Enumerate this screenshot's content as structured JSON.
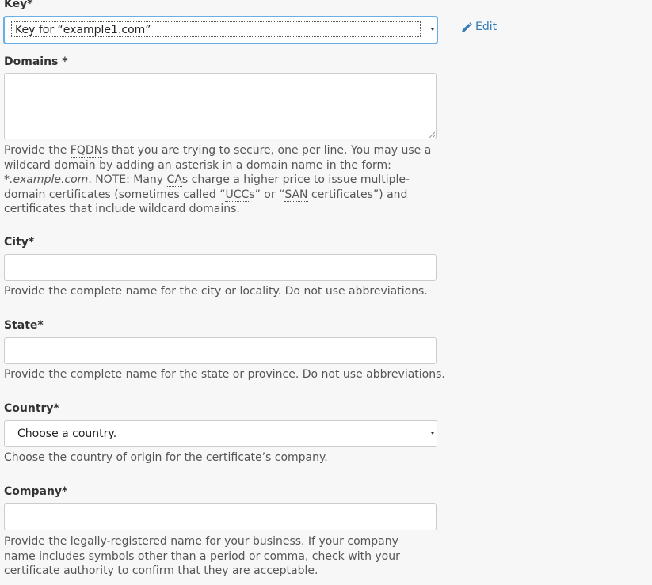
{
  "key": {
    "label": "Key*",
    "selected": "Key for “example1.com”",
    "edit_label": "Edit"
  },
  "domains": {
    "label": "Domains *",
    "value": "",
    "help": {
      "p1": "Provide the ",
      "fqdn": "FQDN",
      "p2": "s that you are trying to secure, one per line. You may use a wildcard domain by adding an asterisk in a domain name in the form: ",
      "wildcard_example": "*.example.com",
      "p3": ". NOTE: Many ",
      "ca": "CA",
      "p4": "s charge a higher price to issue multiple-domain certificates (sometimes called “",
      "ucc": "UCC",
      "p5": "s” or “",
      "san": "SAN",
      "p6": " certificates”) and certificates that include wildcard domains."
    }
  },
  "city": {
    "label": "City*",
    "value": "",
    "help": "Provide the complete name for the city or locality. Do not use abbreviations."
  },
  "state": {
    "label": "State*",
    "value": "",
    "help": "Provide the complete name for the state or province. Do not use abbreviations."
  },
  "country": {
    "label": "Country*",
    "selected": "Choose a country.",
    "help": "Choose the country of origin for the certificate’s company."
  },
  "company": {
    "label": "Company*",
    "value": "",
    "help": "Provide the legally-registered name for your business. If your company name includes symbols other than a period or comma, check with your certificate authority to confirm that they are acceptable."
  },
  "colors": {
    "link": "#337ab7",
    "focus": "#66afe9",
    "border": "#cccccc",
    "background": "#f7f7f7"
  },
  "icons": {
    "edit": "pencil-icon"
  }
}
